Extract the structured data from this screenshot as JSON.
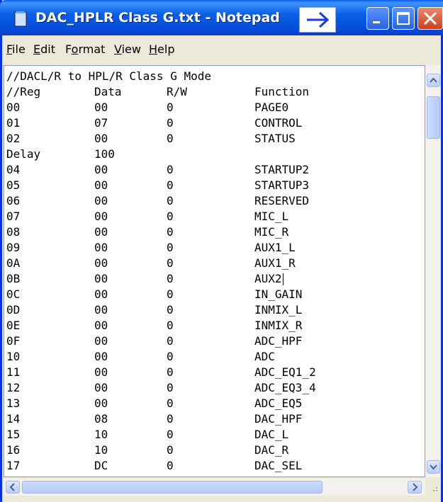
{
  "window": {
    "title": "DAC_HPLR Class G.txt - Notepad",
    "titlebar_color": "#0a5fe8",
    "close_color": "#c9401f"
  },
  "menu": [
    {
      "label": "File",
      "accel": "F",
      "rest": "ile"
    },
    {
      "label": "Edit",
      "accel": "E",
      "rest": "dit"
    },
    {
      "label": "Format",
      "accel": "o",
      "pre": "F",
      "rest": "rmat"
    },
    {
      "label": "View",
      "accel": "V",
      "rest": "iew"
    },
    {
      "label": "Help",
      "accel": "H",
      "rest": "elp"
    }
  ],
  "editor": {
    "header": "//DACL/R to HPL/R Class G Mode",
    "columns": [
      "//Reg",
      "Data",
      "R/W",
      "Function"
    ],
    "rows": [
      [
        "00",
        "00",
        "0",
        "PAGE0"
      ],
      [
        "01",
        "07",
        "0",
        "CONTROL"
      ],
      [
        "02",
        "00",
        "0",
        "STATUS"
      ],
      [
        "Delay",
        "100",
        "",
        ""
      ],
      [
        "04",
        "00",
        "0",
        "STARTUP2"
      ],
      [
        "05",
        "00",
        "0",
        "STARTUP3"
      ],
      [
        "06",
        "00",
        "0",
        "RESERVED"
      ],
      [
        "07",
        "00",
        "0",
        "MIC_L"
      ],
      [
        "08",
        "00",
        "0",
        "MIC_R"
      ],
      [
        "09",
        "00",
        "0",
        "AUX1_L"
      ],
      [
        "0A",
        "00",
        "0",
        "AUX1_R"
      ],
      [
        "0B",
        "00",
        "0",
        "AUX2"
      ],
      [
        "0C",
        "00",
        "0",
        "IN_GAIN"
      ],
      [
        "0D",
        "00",
        "0",
        "INMIX_L"
      ],
      [
        "0E",
        "00",
        "0",
        "INMIX_R"
      ],
      [
        "0F",
        "00",
        "0",
        "ADC_HPF"
      ],
      [
        "10",
        "00",
        "0",
        "ADC"
      ],
      [
        "11",
        "00",
        "0",
        "ADC_EQ1_2"
      ],
      [
        "12",
        "00",
        "0",
        "ADC_EQ3_4"
      ],
      [
        "13",
        "00",
        "0",
        "ADC_EQ5"
      ],
      [
        "14",
        "08",
        "0",
        "DAC_HPF"
      ],
      [
        "15",
        "10",
        "0",
        "DAC_L"
      ],
      [
        "16",
        "10",
        "0",
        "DAC_R"
      ],
      [
        "17",
        "DC",
        "0",
        "DAC_SEL"
      ]
    ]
  },
  "icons": {
    "app": "notepad-icon",
    "arrow": "right-arrow-icon",
    "minimize": "minimize-icon",
    "maximize": "maximize-icon",
    "close": "close-icon"
  }
}
